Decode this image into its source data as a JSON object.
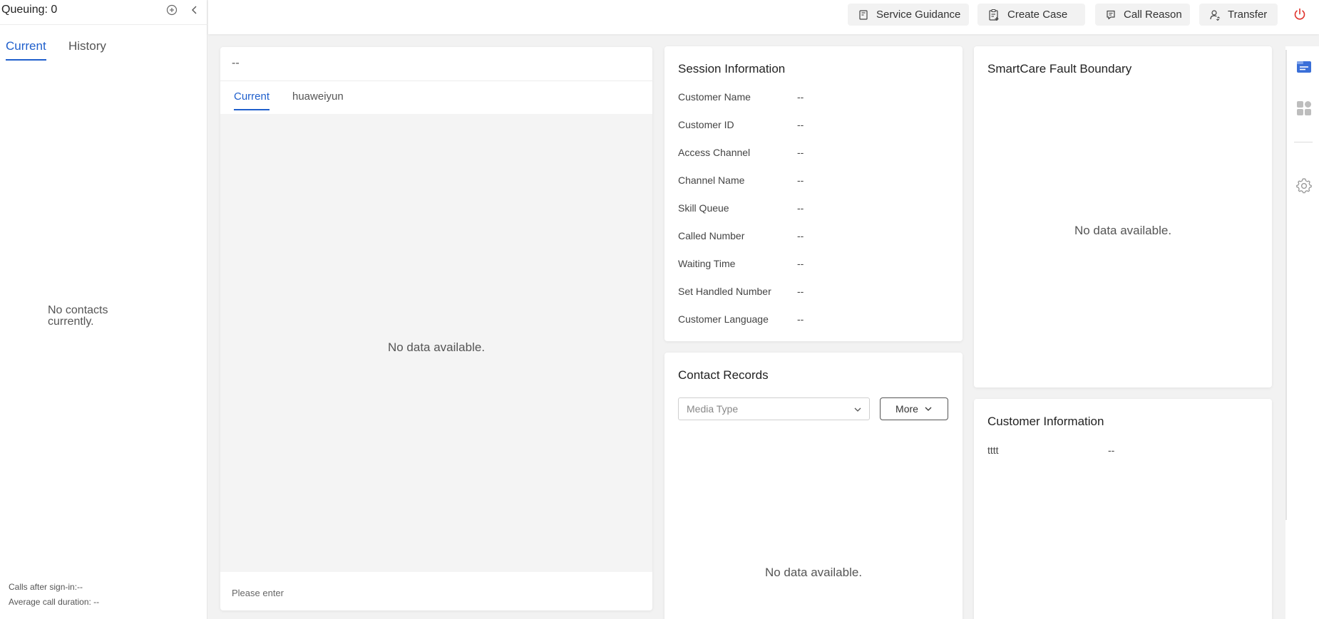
{
  "left_panel": {
    "queue_label": "Queuing: 0",
    "tabs": [
      {
        "label": "Current",
        "active": true
      },
      {
        "label": "History",
        "active": false
      }
    ],
    "empty_text": "No contacts currently.",
    "footer": {
      "calls_after_signin": "Calls after sign-in:--",
      "avg_call_duration": "Average call duration: --"
    }
  },
  "toolbar": {
    "service_guidance": "Service Guidance",
    "create_case": "Create Case",
    "call_reason": "Call Reason",
    "transfer": "Transfer"
  },
  "chat": {
    "title": "--",
    "tabs": [
      {
        "label": "Current",
        "active": true
      },
      {
        "label": "huaweiyun",
        "active": false
      }
    ],
    "empty_text": "No data available.",
    "input_placeholder": "Please enter"
  },
  "session": {
    "title": "Session Information",
    "rows": [
      {
        "label": "Customer Name",
        "value": "--"
      },
      {
        "label": "Customer ID",
        "value": "--"
      },
      {
        "label": "Access Channel",
        "value": "--"
      },
      {
        "label": "Channel Name",
        "value": "--"
      },
      {
        "label": "Skill Queue",
        "value": "--"
      },
      {
        "label": "Called Number",
        "value": "--"
      },
      {
        "label": "Waiting Time",
        "value": "--"
      },
      {
        "label": "Set Handled Number",
        "value": "--"
      },
      {
        "label": "Customer Language",
        "value": "--"
      }
    ]
  },
  "records": {
    "title": "Contact Records",
    "media_type_placeholder": "Media Type",
    "more_label": "More",
    "empty_text": "No data available."
  },
  "smartcare": {
    "title": "SmartCare Fault Boundary",
    "empty_text": "No data available."
  },
  "customer_info": {
    "title": "Customer Information",
    "rows": [
      {
        "label": "tttt",
        "value": "--"
      }
    ]
  },
  "colors": {
    "accent": "#1f5fcc",
    "power": "#e0322b",
    "rail_active": "#3a6fd8"
  },
  "icons": {
    "queue_add": "plus-circle-icon",
    "collapse": "chevron-left-icon",
    "service_guidance": "guide-book-icon",
    "create_case": "clipboard-add-icon",
    "call_reason": "comment-list-icon",
    "transfer": "user-transfer-icon",
    "power": "power-icon",
    "rail": [
      "card-panel-icon",
      "apps-grid-icon",
      "settings-gear-icon"
    ]
  }
}
